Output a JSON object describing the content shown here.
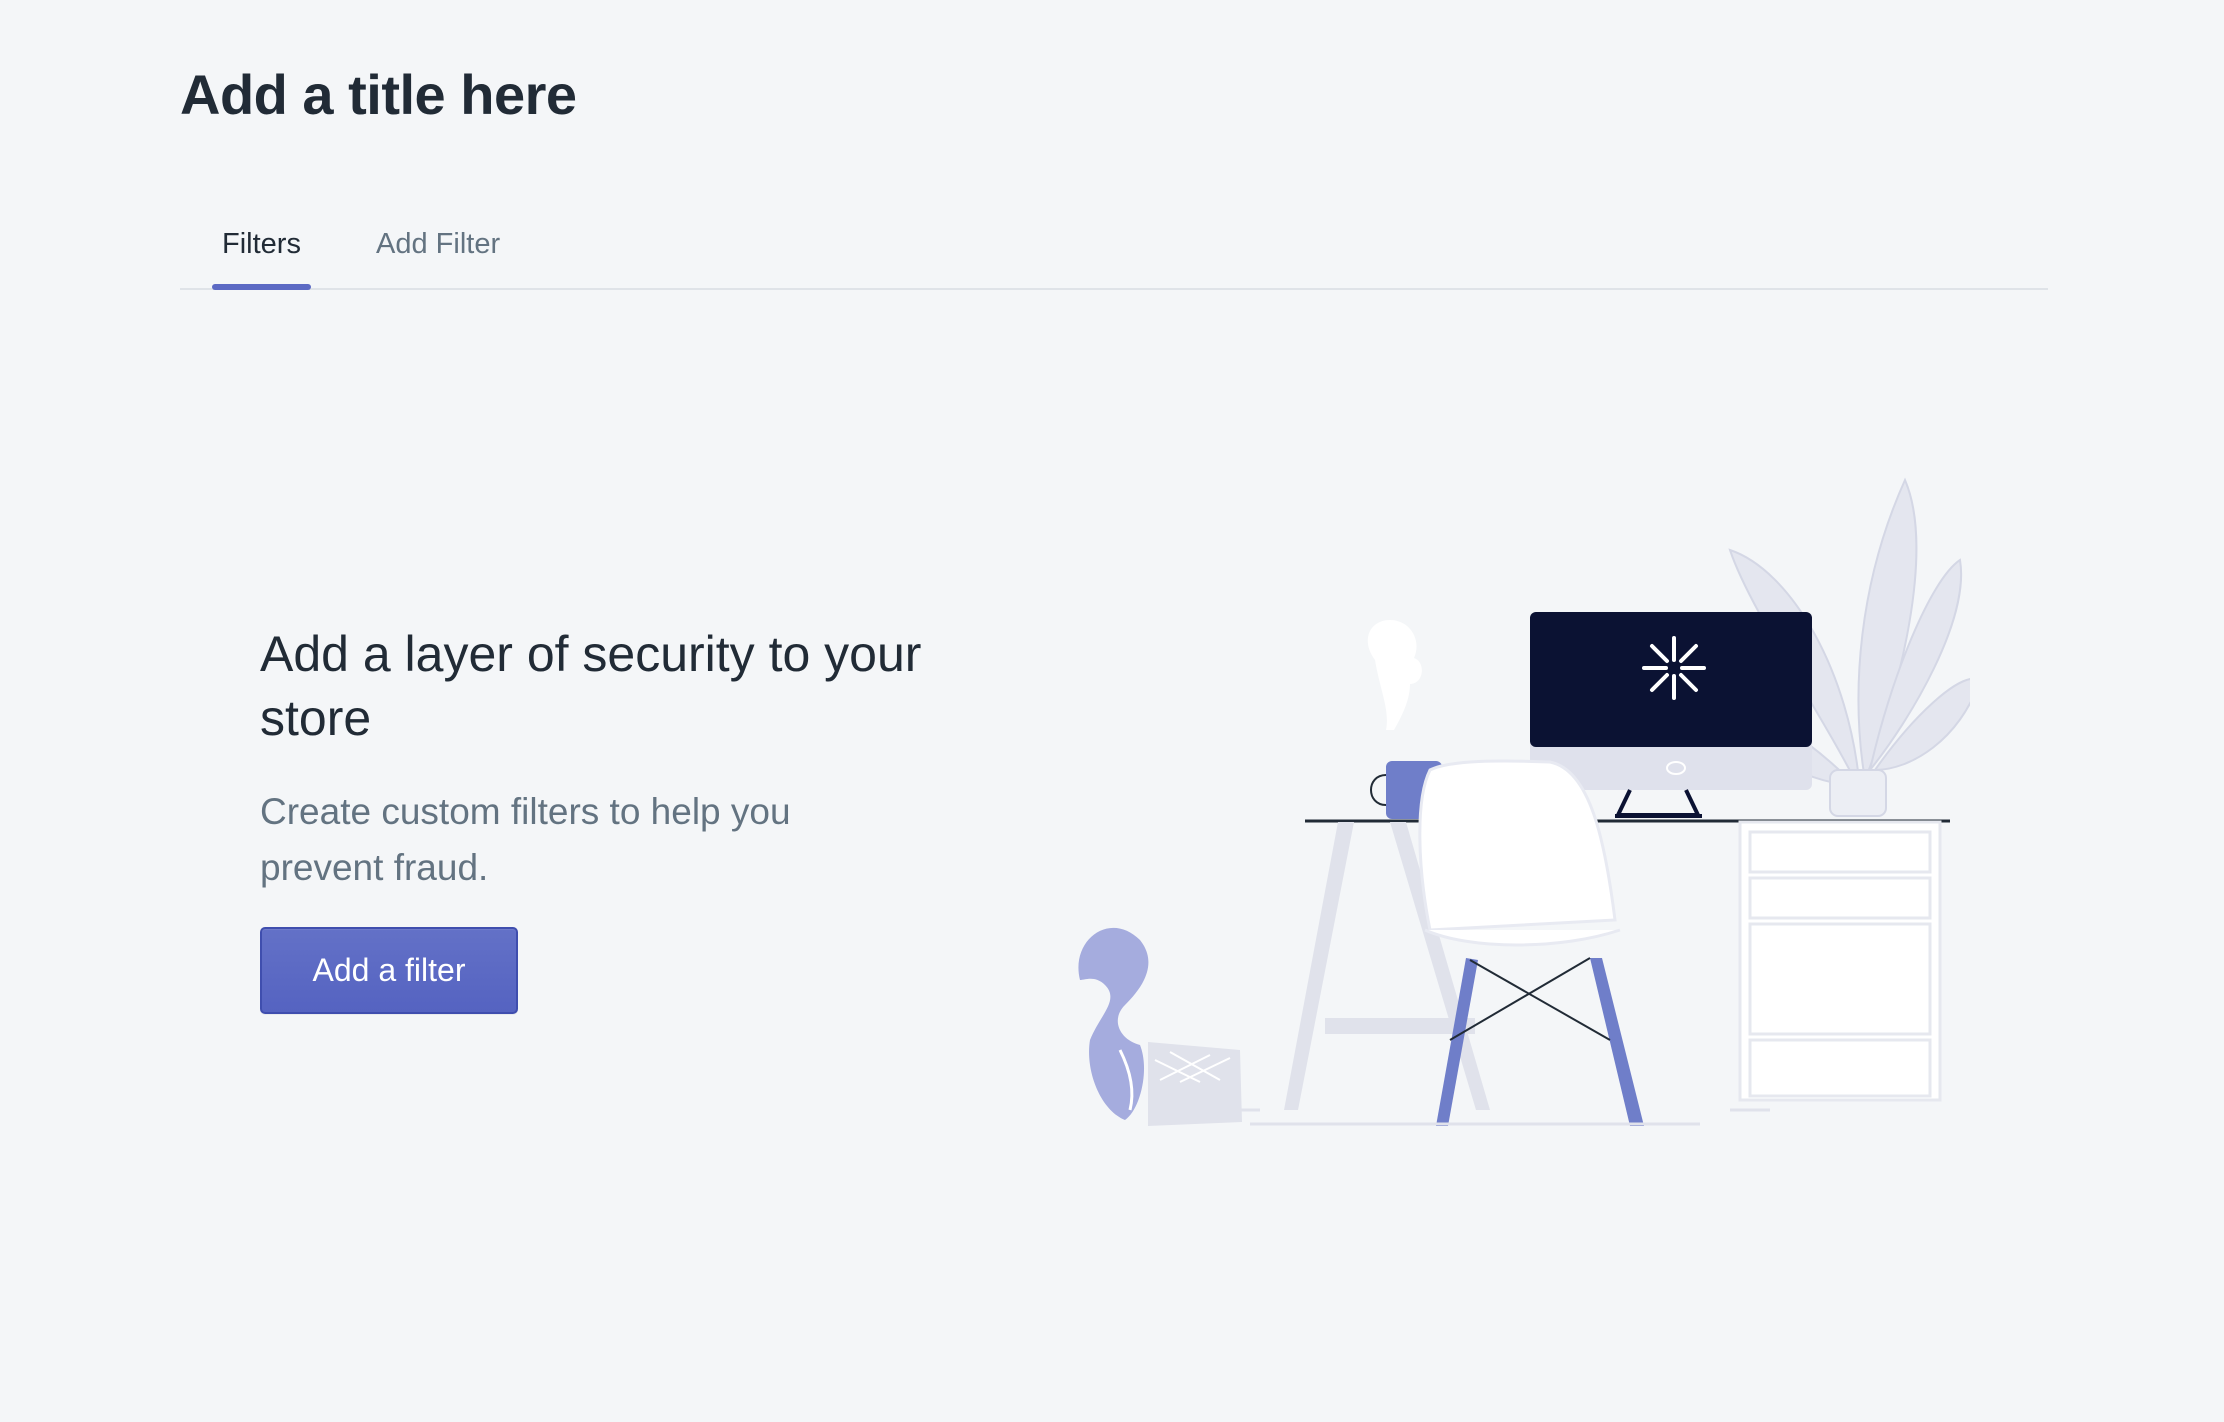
{
  "page": {
    "title": "Add a title here"
  },
  "tabs": [
    {
      "label": "Filters",
      "selected": true
    },
    {
      "label": "Add Filter",
      "selected": false
    }
  ],
  "empty_state": {
    "heading": "Add a layer of security to your store",
    "description": "Create custom filters to help you prevent fraud.",
    "action_label": "Add a filter",
    "illustration": "desk-workspace-illustration"
  },
  "colors": {
    "background": "#f4f6f8",
    "accent": "#5c6ac4",
    "heading_text": "#212b36",
    "subdued_text": "#637381",
    "monitor_screen": "#0b1233",
    "illustration_blue": "#6f7ec9",
    "illustration_light": "#dfe1ec"
  }
}
